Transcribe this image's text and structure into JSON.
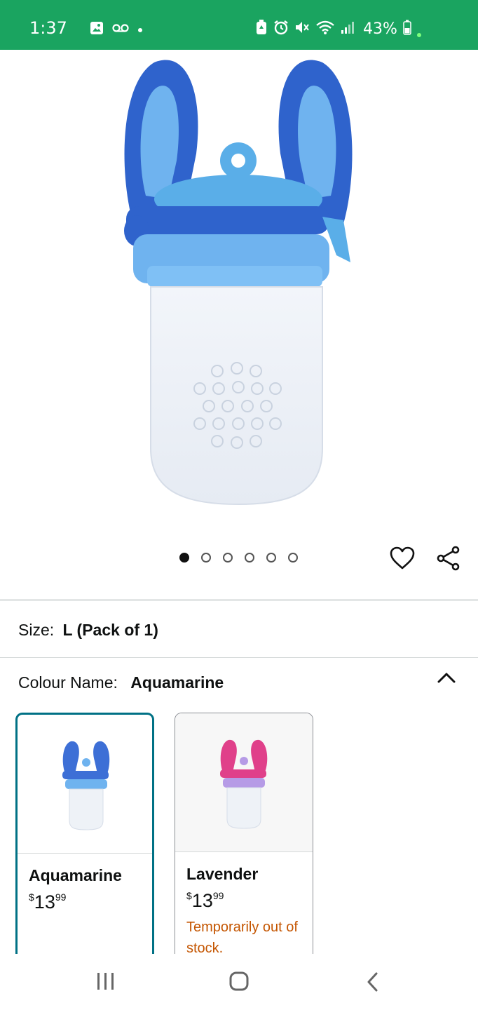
{
  "status_bar": {
    "time": "1:37",
    "battery": "43%",
    "bg_color": "#1aa460",
    "left_icons": [
      "gallery-icon",
      "voicemail-icon",
      "notification-dot-icon"
    ],
    "right_icons": [
      "battery-saver-icon",
      "alarm-icon",
      "mute-icon",
      "wifi-icon",
      "signal-icon",
      "battery-icon"
    ]
  },
  "product_gallery": {
    "image_count": 6,
    "active_index": 0,
    "image_subject": "blue baby food feeder"
  },
  "actions": {
    "favorite_icon": "heart-icon",
    "share_icon": "share-icon"
  },
  "size": {
    "label": "Size:",
    "value": "L (Pack of 1)"
  },
  "colour": {
    "label": "Colour Name:",
    "value": "Aquamarine",
    "toggle_icon": "chevron-up-icon",
    "options": [
      {
        "name": "Aquamarine",
        "currency": "$",
        "price_whole": "13",
        "price_cents": "99",
        "stock": "",
        "selected": true,
        "accent": "#3d6fd6"
      },
      {
        "name": "Lavender",
        "currency": "$",
        "price_whole": "13",
        "price_cents": "99",
        "stock": "Temporarily out of stock.",
        "selected": false,
        "accent": "#e0408a"
      }
    ]
  },
  "nav_bar": {
    "icons": [
      "recent-apps-icon",
      "home-icon",
      "back-icon"
    ]
  }
}
